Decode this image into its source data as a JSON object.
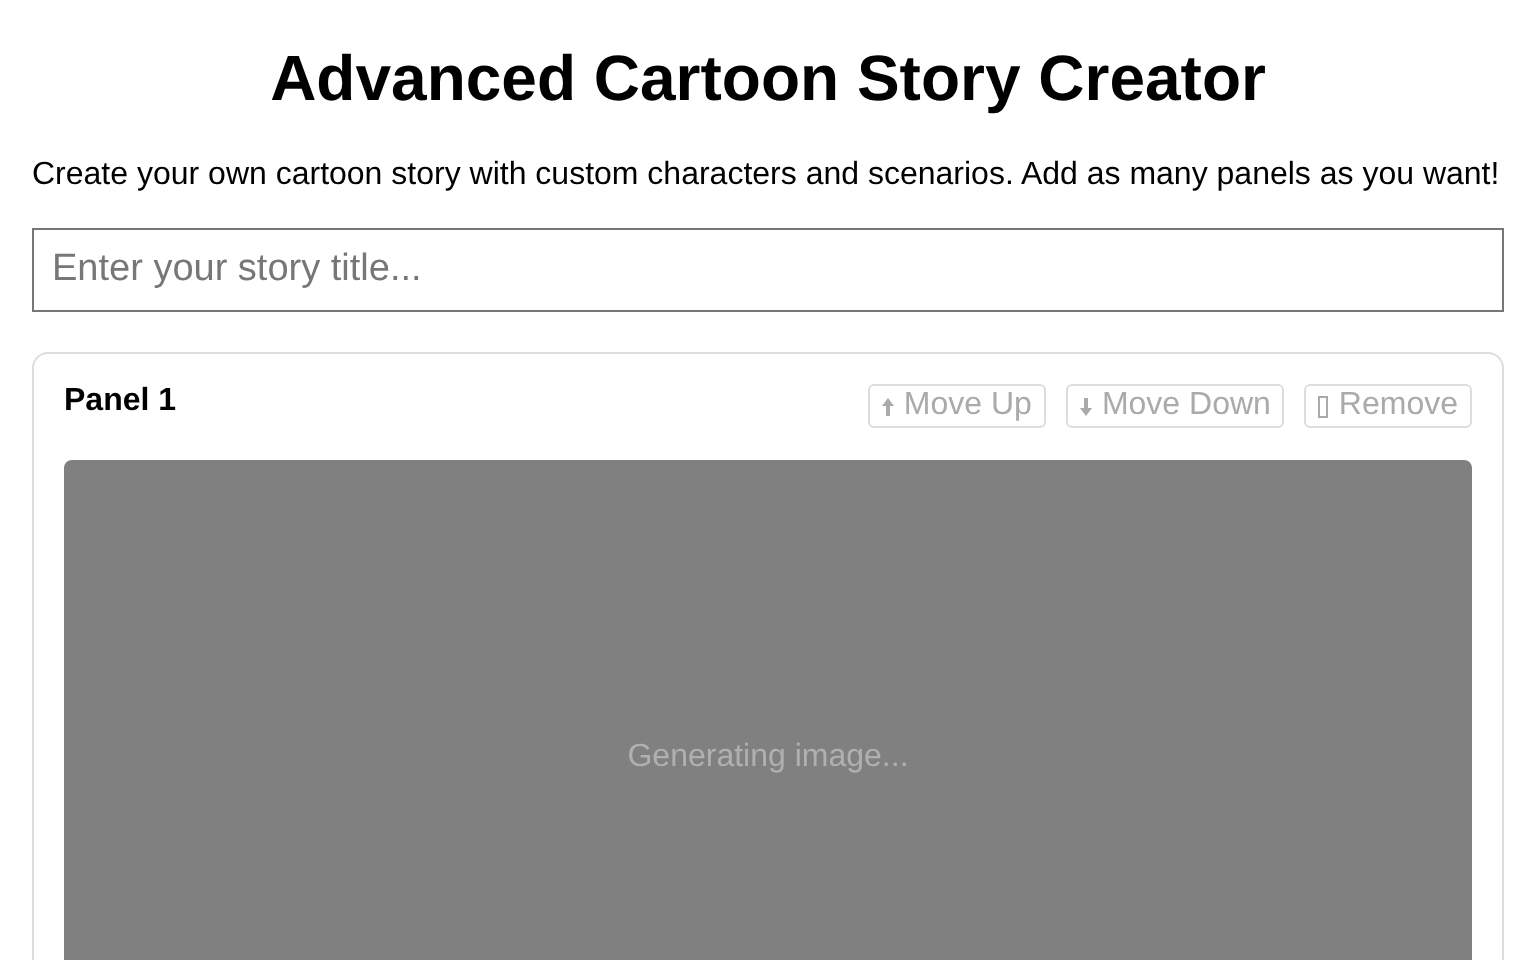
{
  "title": "Advanced Cartoon Story Creator",
  "intro": "Create your own cartoon story with custom characters and scenarios. Add as many panels as you want!",
  "story_title": {
    "placeholder": "Enter your story title..."
  },
  "panels": [
    {
      "label": "Panel 1",
      "status": "Generating image...",
      "buttons": [
        {
          "kind": "up",
          "label": "Move Up",
          "disabled": true
        },
        {
          "kind": "down",
          "label": "Move Down",
          "disabled": true
        },
        {
          "kind": "remove",
          "label": "Remove",
          "disabled": true
        }
      ]
    }
  ]
}
